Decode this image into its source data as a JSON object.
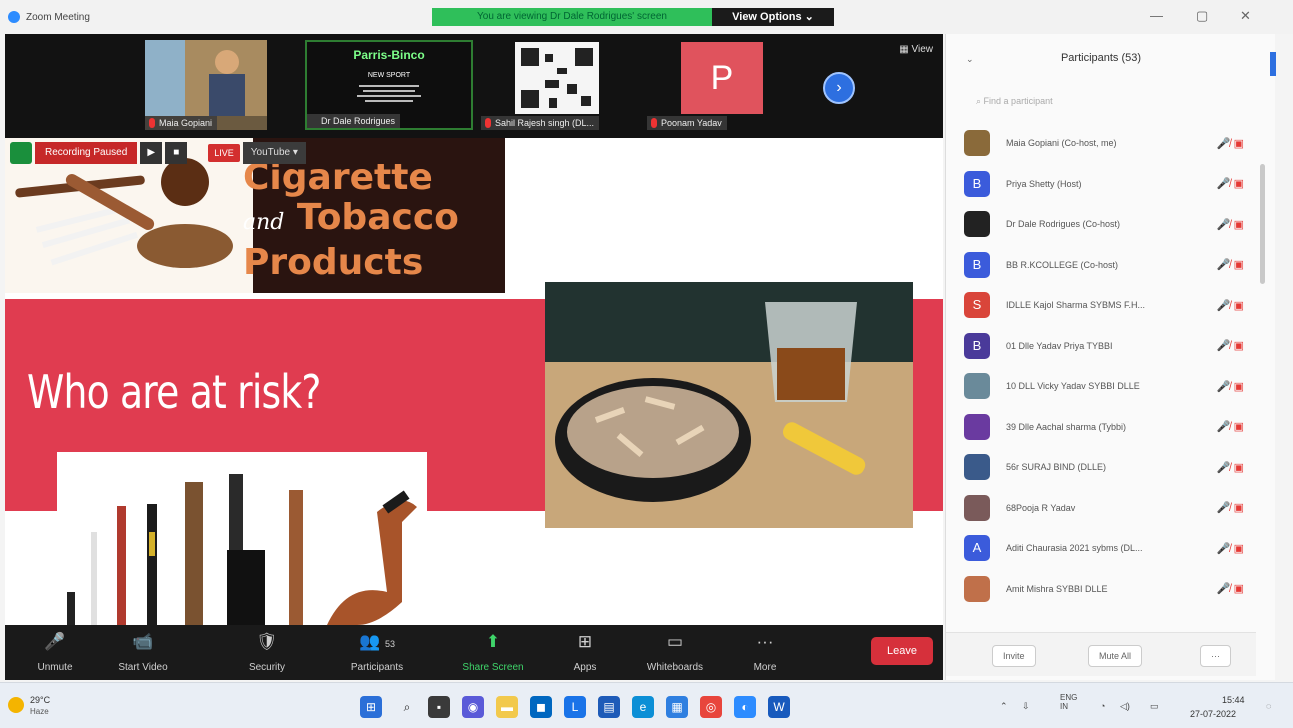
{
  "window": {
    "title": "Zoom Meeting",
    "viewing_banner": "You are viewing Dr Dale Rodrigues' screen",
    "view_options": "View Options ⌄",
    "controls": [
      "—",
      "▢",
      "✕"
    ]
  },
  "video_strip": {
    "view_label": "View",
    "next_icon": "chevron-right-icon",
    "tiles": [
      {
        "name": "Maia Gopiani"
      },
      {
        "name": "Dr Dale Rodrigues",
        "header": "Parris-Binco",
        "line1": "NEW SPORT"
      },
      {
        "name": "Sahil Rajesh singh (DL..."
      },
      {
        "name": "Poonam Yadav",
        "initial": "P"
      }
    ]
  },
  "recording": {
    "status": "Recording Paused",
    "play": "▶",
    "stop": "■",
    "live": "LIVE",
    "stream": "YouTube ▾"
  },
  "slide": {
    "title_line1": "Cigarette",
    "title_and": "and",
    "title_line2": "Tobacco",
    "title_line3": "Products",
    "heading": "Who are at risk?"
  },
  "toolbar": {
    "items": [
      {
        "label": "Unmute",
        "icon": "🎤"
      },
      {
        "label": "Start Video",
        "icon": "📹"
      },
      {
        "label": "Security",
        "icon": "🛡"
      },
      {
        "label": "Participants",
        "icon": "👥",
        "count": "53"
      },
      {
        "label": "Share Screen",
        "icon": "⬆"
      },
      {
        "label": "Apps",
        "icon": "⊞"
      },
      {
        "label": "Whiteboards",
        "icon": "▭"
      },
      {
        "label": "More",
        "icon": "···"
      }
    ],
    "leave": "Leave"
  },
  "participants": {
    "title": "Participants (53)",
    "search_placeholder": "Find a participant",
    "list": [
      {
        "name": "Maia Gopiani (Co-host, me)",
        "avatar": "",
        "color": "#8a6a3a"
      },
      {
        "name": "Priya Shetty (Host)",
        "avatar": "B",
        "color": "#3b5bdb"
      },
      {
        "name": "Dr Dale Rodrigues (Co-host)",
        "avatar": "",
        "color": "#222222"
      },
      {
        "name": "BB R.KCOLLEGE (Co-host)",
        "avatar": "B",
        "color": "#3b5bdb"
      },
      {
        "name": "IDLLE Kajol Sharma SYBMS F.H...",
        "avatar": "S",
        "color": "#d9453a"
      },
      {
        "name": "01 Dlle Yadav Priya TYBBI",
        "avatar": "B",
        "color": "#4a3a9a"
      },
      {
        "name": "10 DLL Vicky Yadav SYBBI DLLE",
        "avatar": "",
        "color": "#6a8a9a"
      },
      {
        "name": "39 Dlle Aachal sharma (Tybbi)",
        "avatar": "",
        "color": "#6a3aa0"
      },
      {
        "name": "56r SURAJ BIND (DLLE)",
        "avatar": "",
        "color": "#3a5a8a"
      },
      {
        "name": "68Pooja R Yadav",
        "avatar": "",
        "color": "#7a5a5a"
      },
      {
        "name": "Aditi Chaurasia 2021 sybms (DL...",
        "avatar": "A",
        "color": "#3b5bdb"
      },
      {
        "name": "Amit Mishra SYBBI DLLE",
        "avatar": "",
        "color": "#c0704a"
      }
    ],
    "invite": "Invite",
    "mute_all": "Mute All",
    "more": "···"
  },
  "taskbar": {
    "temp": "29°C",
    "weather": "Haze",
    "lang_top": "ENG",
    "lang_bottom": "IN",
    "time": "15:44",
    "date": "27-07-2022"
  }
}
